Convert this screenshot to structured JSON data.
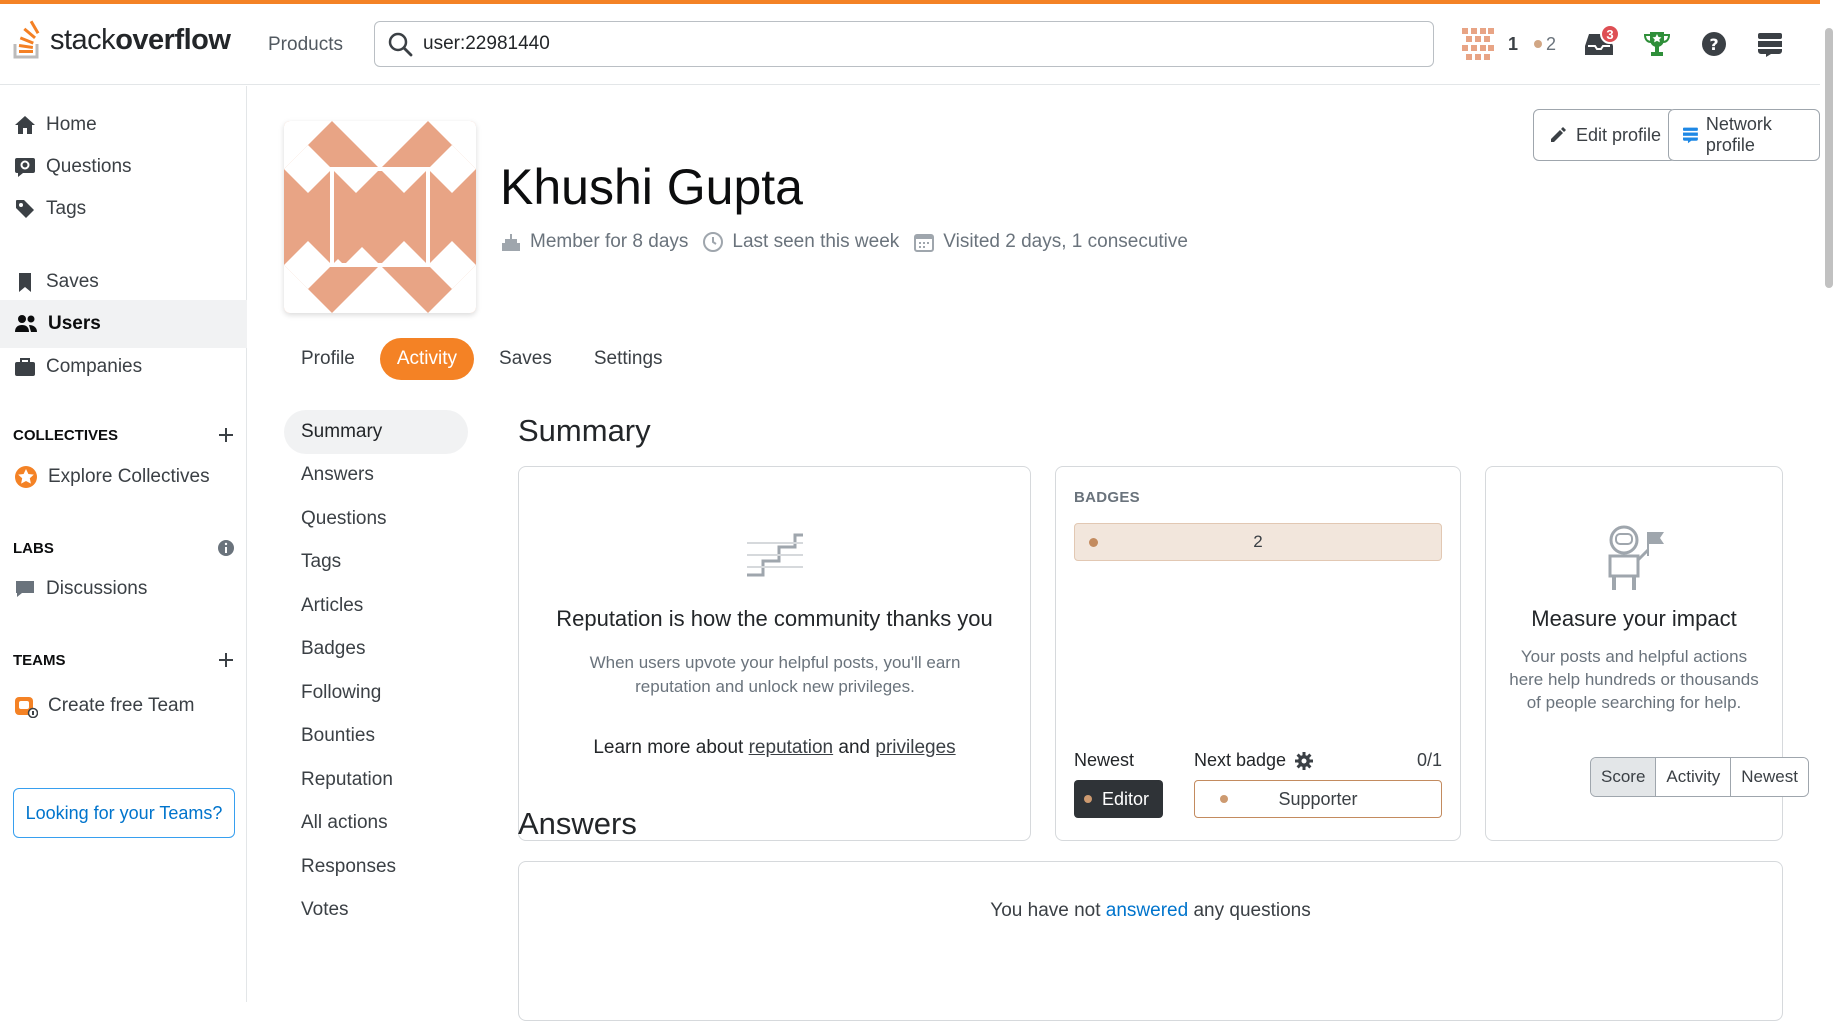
{
  "header": {
    "logo": {
      "prefix": "stack",
      "bold": "overflow"
    },
    "products_label": "Products",
    "search": {
      "value": "user:22981440",
      "icon": "search-icon"
    },
    "reputation": "1",
    "bronze_count": "2",
    "inbox_count": "3"
  },
  "leftnav": {
    "items": [
      {
        "label": "Home",
        "icon": "home-icon"
      },
      {
        "label": "Questions",
        "icon": "questions-icon"
      },
      {
        "label": "Tags",
        "icon": "tag-icon"
      },
      {
        "label": "Saves",
        "icon": "bookmark-icon"
      },
      {
        "label": "Users",
        "icon": "users-icon"
      },
      {
        "label": "Companies",
        "icon": "briefcase-icon"
      }
    ],
    "collectives_heading": "COLLECTIVES",
    "explore_collectives": "Explore Collectives",
    "labs_heading": "LABS",
    "discussions": "Discussions",
    "teams_heading": "TEAMS",
    "create_team": "Create free Team",
    "looking_for_teams": "Looking for your Teams?"
  },
  "profile": {
    "name": "Khushi Gupta",
    "member_for": "Member for 8 days",
    "last_seen": "Last seen this week",
    "visited": "Visited 2 days, 1 consecutive",
    "edit_profile": "Edit profile",
    "network_profile": "Network profile",
    "avatar_color": "#e8a485"
  },
  "tabs": [
    "Profile",
    "Activity",
    "Saves",
    "Settings"
  ],
  "subnav": [
    "Summary",
    "Answers",
    "Questions",
    "Tags",
    "Articles",
    "Badges",
    "Following",
    "Bounties",
    "Reputation",
    "All actions",
    "Responses",
    "Votes"
  ],
  "summary": {
    "title": "Summary",
    "reputation_card": {
      "title": "Reputation is how the community thanks you",
      "description": "When users upvote your helpful posts, you'll earn reputation and unlock new privileges.",
      "learn_prefix": "Learn more about",
      "reputation_link": "reputation",
      "and": "and",
      "privileges_link": "privileges"
    },
    "badges_card": {
      "heading": "BADGES",
      "bronze_count": "2",
      "newest_label": "Newest",
      "newest_badge": "Editor",
      "next_badge_label": "Next badge",
      "next_badge_progress": "0/1",
      "next_badge": "Supporter"
    },
    "impact_card": {
      "title": "Measure your impact",
      "description": "Your posts and helpful actions here help hundreds or thousands of people searching for help."
    }
  },
  "answers": {
    "title": "Answers",
    "filters": [
      "Score",
      "Activity",
      "Newest"
    ],
    "empty_prefix": "You have not",
    "empty_link": "answered",
    "empty_suffix": "any questions"
  },
  "colors": {
    "accent": "#f48225",
    "link": "#0074cc",
    "bronze": "#c38b5f"
  }
}
